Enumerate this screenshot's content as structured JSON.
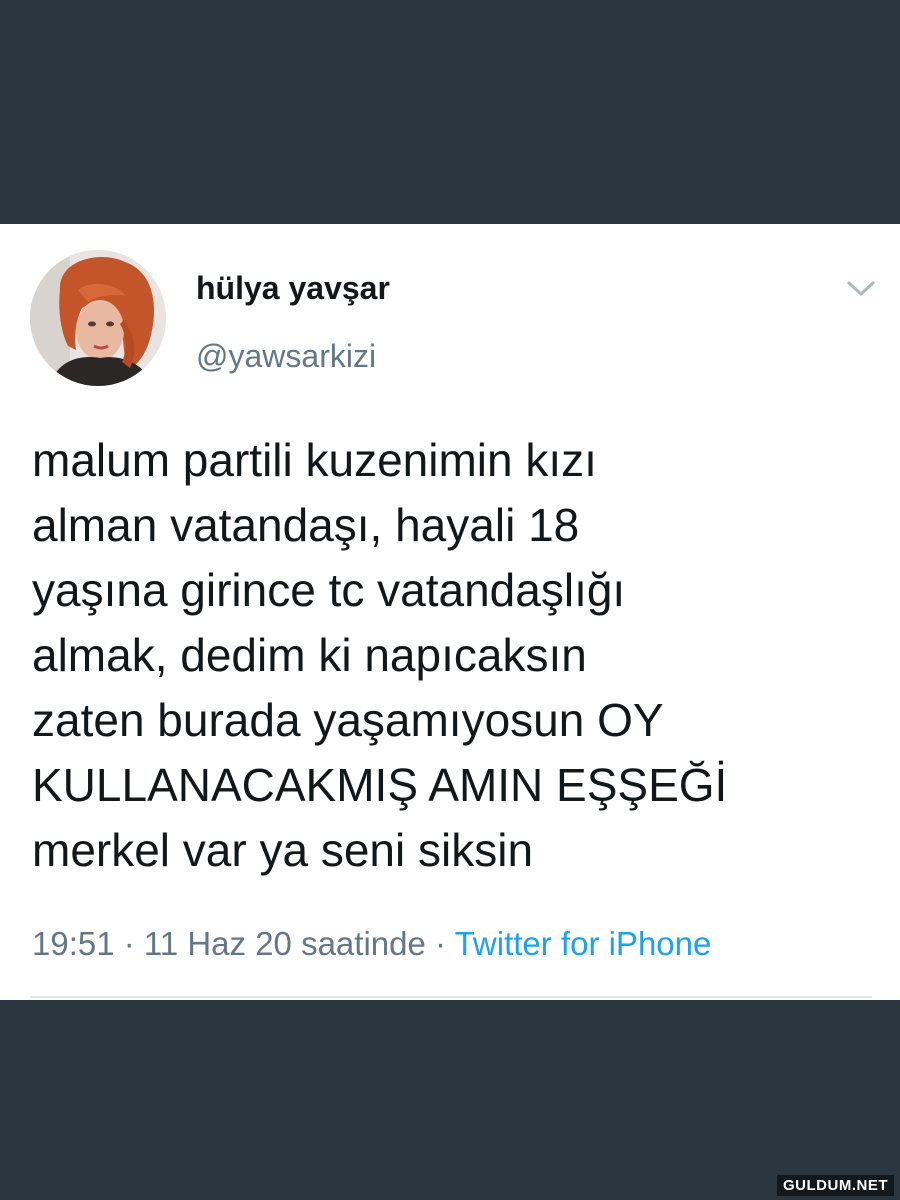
{
  "tweet": {
    "author": {
      "display_name": "hülya yavşar",
      "handle": "@yawsarkizi"
    },
    "text_lines": [
      "malum partili kuzenimin kızı",
      "alman vatandaşı, hayali 18",
      "yaşına girince tc vatandaşlığı",
      "almak, dedim ki napıcaksın",
      "zaten burada yaşamıyosun OY",
      "KULLANACAKMIŞ AMIN EŞŞEĞİ",
      "merkel var ya seni siksin"
    ],
    "meta": {
      "time": "19:51",
      "separator": " · ",
      "date": "11 Haz 20 saatinde",
      "source": "Twitter for iPhone"
    }
  },
  "watermark": "GULDUM.NET",
  "colors": {
    "band": "#2a353e",
    "card": "#ffffff",
    "text": "#14171a",
    "secondary": "#657786",
    "link": "#1da1f2"
  },
  "icons": {
    "menu": "chevron-down-icon"
  }
}
